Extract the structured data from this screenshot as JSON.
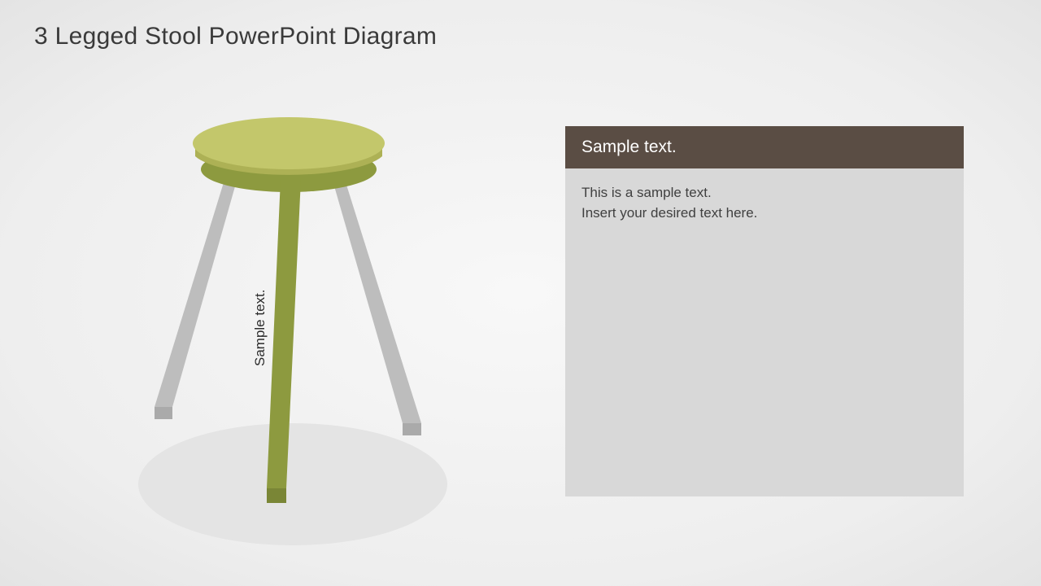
{
  "title": "3 Legged Stool PowerPoint Diagram",
  "stool": {
    "leg_label": "Sample text.",
    "colors": {
      "seat_top": "#c3c76b",
      "seat_side": "#adb155",
      "leg_highlighted": "#8d9a3f",
      "leg_highlighted_shadow": "#7a8636",
      "leg_muted": "#bdbdbd",
      "leg_muted_shadow": "#aaaaaa"
    }
  },
  "panel": {
    "header": "Sample text.",
    "body": "This is a sample text.\nInsert your desired text here."
  }
}
